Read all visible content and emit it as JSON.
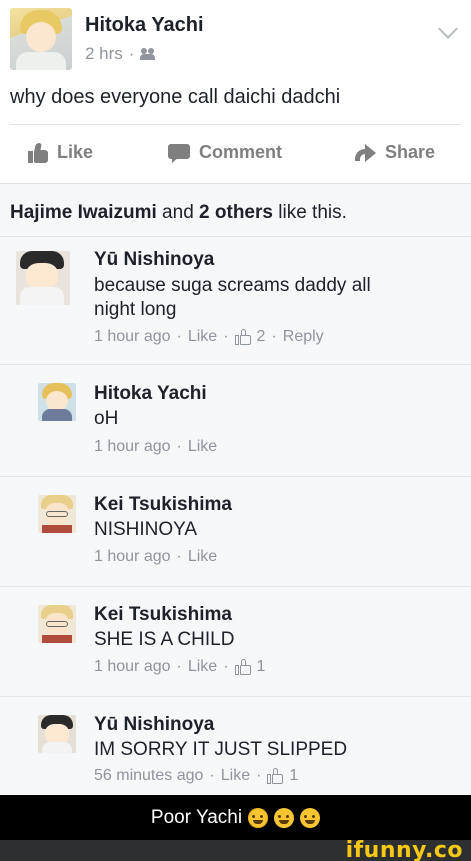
{
  "post": {
    "author": "Hitoka Yachi",
    "time": "2 hrs",
    "separator": "·",
    "text": "why does everyone call daichi dadchi",
    "actions": {
      "like": "Like",
      "comment": "Comment",
      "share": "Share"
    }
  },
  "likes_summary": {
    "name": "Hajime Iwaizumi",
    "middle": " and ",
    "others": "2 others",
    "suffix": " like this."
  },
  "comments": [
    {
      "author": "Yū Nishinoya",
      "line1": "because suga screams daddy all",
      "line2": "night long",
      "time": "1 hour ago",
      "like": "Like",
      "sep": "·",
      "likes": "2",
      "reply": "Reply"
    },
    {
      "author": "Hitoka Yachi",
      "text": "oH",
      "time": "1 hour ago",
      "like": "Like",
      "sep": "·"
    },
    {
      "author": "Kei Tsukishima",
      "text": "NISHINOYA",
      "time": "1 hour ago",
      "like": "Like",
      "sep": "·"
    },
    {
      "author": "Kei Tsukishima",
      "text": "SHE IS A CHILD",
      "time": "1 hour ago",
      "like": "Like",
      "sep": "·",
      "likes": "1"
    },
    {
      "author": "Yū Nishinoya",
      "text": "IM SORRY IT JUST SLIPPED",
      "time": "56 minutes ago",
      "like": "Like",
      "sep": "·",
      "likes": "1"
    }
  ],
  "caption": "Poor Yachi",
  "brand": "ifunny.co",
  "icons": [
    "chevron-down-icon",
    "friends-icon",
    "thumbs-up-icon",
    "comment-icon",
    "share-icon",
    "crying-laughing-emoji",
    "rolling-laughing-emoji"
  ]
}
